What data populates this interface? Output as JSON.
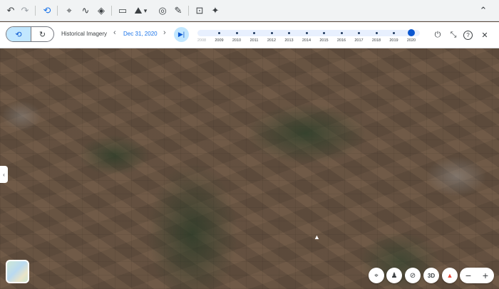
{
  "toolbar": {
    "undo_icon": "↶",
    "redo_icon": "↷",
    "history_icon": "⟲",
    "pin_icon": "⌖",
    "path_icon": "∿",
    "layers_icon": "◈",
    "ruler_icon": "▭",
    "image_icon": "⛰",
    "image_dropdown_icon": "▾",
    "compare_icon": "◎",
    "tools_icon": "✎",
    "capture_icon": "⊡",
    "sparkle_icon": "✦",
    "collapse_icon": "⌃"
  },
  "historical": {
    "mode_a_icon": "⟲",
    "mode_b_icon": "↻",
    "label": "Historical Imagery",
    "prev_icon": "‹",
    "date": "Dec 31, 2020",
    "next_icon": "›",
    "jump_icon": "▶|",
    "years": [
      "2008",
      "2009",
      "2010",
      "2011",
      "2012",
      "2013",
      "2014",
      "2015",
      "2016",
      "2017",
      "2018",
      "2019",
      "2020"
    ],
    "selected_year": "2020",
    "right_icons": {
      "timelapse": "⏻",
      "collapse": "⤡",
      "help": "?",
      "close": "✕"
    }
  },
  "map": {
    "side_tab_icon": "‹",
    "controls": {
      "locate": "⌖",
      "pegman": "♟",
      "compass_off": "⊘",
      "three_d": "3D",
      "north": "▲",
      "zoom_out": "−",
      "zoom_in": "+"
    }
  }
}
